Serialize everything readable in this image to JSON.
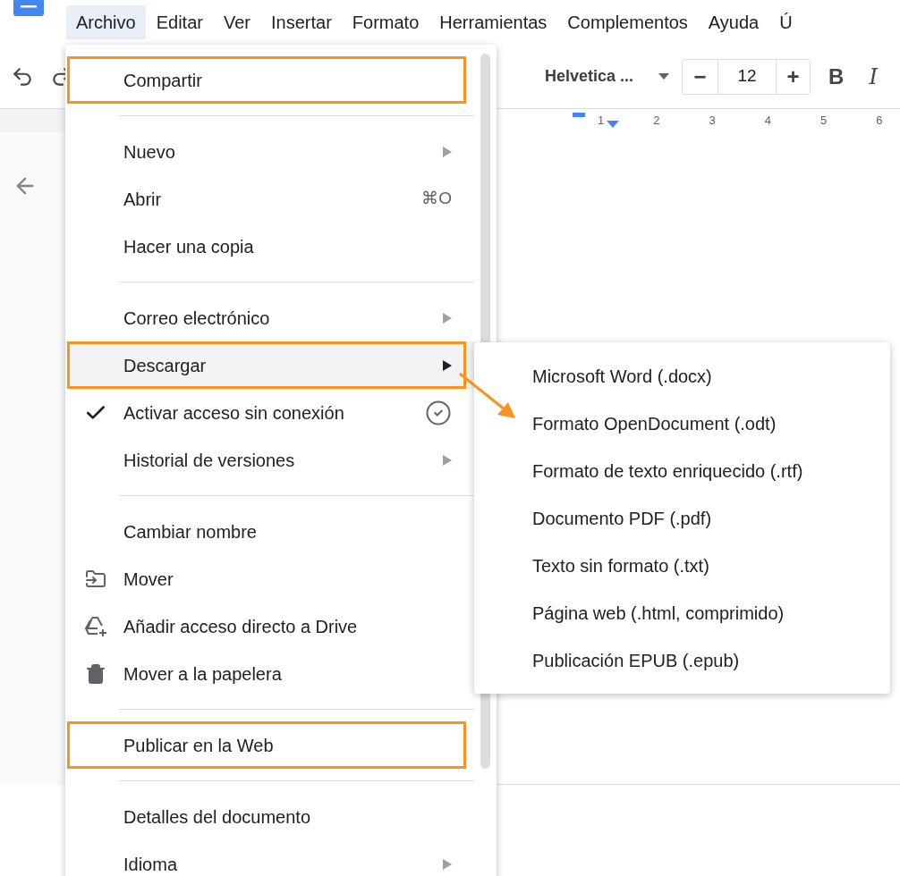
{
  "menubar": {
    "items": [
      {
        "label": "Archivo",
        "selected": true
      },
      {
        "label": "Editar",
        "selected": false
      },
      {
        "label": "Ver",
        "selected": false
      },
      {
        "label": "Insertar",
        "selected": false
      },
      {
        "label": "Formato",
        "selected": false
      },
      {
        "label": "Herramientas",
        "selected": false
      },
      {
        "label": "Complementos",
        "selected": false
      },
      {
        "label": "Ayuda",
        "selected": false
      },
      {
        "label": "Ú",
        "selected": false
      }
    ]
  },
  "toolbar": {
    "font": "Helvetica ...",
    "minus": "−",
    "size": "12",
    "plus": "+",
    "bold": "B",
    "italic": "I"
  },
  "ruler": {
    "labels": [
      "1",
      "2",
      "3",
      "4",
      "5",
      "6"
    ]
  },
  "file_menu": {
    "items": [
      {
        "kind": "plain",
        "label": "Compartir",
        "selected": false,
        "checked": false,
        "submenu": false,
        "annotated": true
      },
      {
        "kind": "divider"
      },
      {
        "kind": "plain",
        "label": "Nuevo",
        "selected": false,
        "checked": false,
        "submenu": true,
        "annotated": false
      },
      {
        "kind": "plain",
        "label": "Abrir",
        "shortcut": "⌘O",
        "selected": false,
        "checked": false,
        "submenu": false,
        "annotated": false
      },
      {
        "kind": "plain",
        "label": "Hacer una copia",
        "selected": false,
        "checked": false,
        "submenu": false,
        "annotated": false
      },
      {
        "kind": "divider"
      },
      {
        "kind": "plain",
        "label": "Correo electrónico",
        "selected": false,
        "checked": false,
        "submenu": true,
        "annotated": false
      },
      {
        "kind": "plain",
        "label": "Descargar",
        "selected": true,
        "checked": false,
        "submenu": true,
        "annotated": true
      },
      {
        "kind": "offline",
        "label": "Activar acceso sin conexión",
        "selected": false,
        "checked": true,
        "submenu": false,
        "annotated": false
      },
      {
        "kind": "plain",
        "label": "Historial de versiones",
        "selected": false,
        "checked": false,
        "submenu": true,
        "annotated": false
      },
      {
        "kind": "divider"
      },
      {
        "kind": "plain",
        "label": "Cambiar nombre",
        "selected": false,
        "checked": false,
        "submenu": false,
        "annotated": false
      },
      {
        "kind": "folder",
        "label": "Mover",
        "selected": false,
        "checked": false,
        "submenu": false,
        "annotated": false
      },
      {
        "kind": "drive",
        "label": "Añadir acceso directo a Drive",
        "selected": false,
        "checked": false,
        "submenu": false,
        "annotated": false
      },
      {
        "kind": "trash",
        "label": "Mover a la papelera",
        "selected": false,
        "checked": false,
        "submenu": false,
        "annotated": false
      },
      {
        "kind": "divider"
      },
      {
        "kind": "plain",
        "label": "Publicar en la Web",
        "selected": false,
        "checked": false,
        "submenu": false,
        "annotated": true
      },
      {
        "kind": "divider"
      },
      {
        "kind": "plain",
        "label": "Detalles del documento",
        "selected": false,
        "checked": false,
        "submenu": false,
        "annotated": false
      },
      {
        "kind": "plain",
        "label": "Idioma",
        "selected": false,
        "checked": false,
        "submenu": true,
        "annotated": false
      }
    ]
  },
  "download_submenu": {
    "items": [
      "Microsoft Word (.docx)",
      "Formato OpenDocument (.odt)",
      "Formato de texto enriquecido (.rtf)",
      "Documento PDF (.pdf)",
      "Texto sin formato (.txt)",
      "Página web (.html, comprimido)",
      "Publicación EPUB (.epub)"
    ]
  }
}
